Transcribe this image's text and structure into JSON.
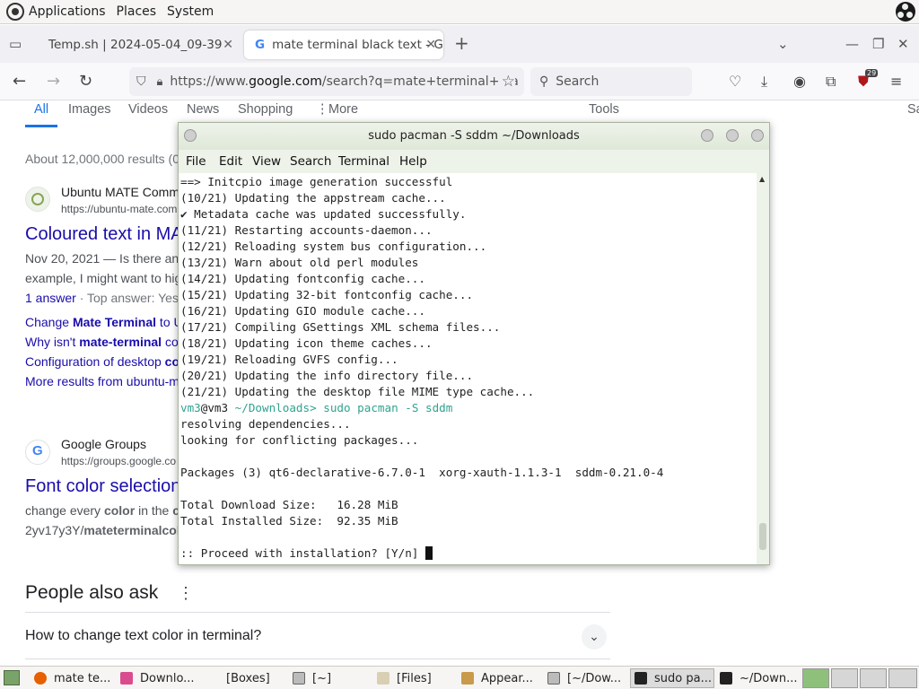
{
  "top_panel": {
    "menus": [
      "Applications",
      "Places",
      "System"
    ]
  },
  "browser": {
    "tabs": [
      {
        "title": "Temp.sh | 2024-05-04_09-39",
        "close": "✕"
      },
      {
        "title": "mate terminal black text - G",
        "close": "✕"
      }
    ],
    "new_tab": "+",
    "url_prefix": "https://www.",
    "url_domain": "google.com",
    "url_rest": "/search?q=mate+terminal+bla",
    "search_placeholder": "Search",
    "badge_count": "29"
  },
  "google": {
    "tabs": [
      "All",
      "Images",
      "Videos",
      "News",
      "Shopping",
      "More",
      "Tools",
      "Sa"
    ],
    "results_count": "About 12,000,000 results (0",
    "result1": {
      "site": "Ubuntu MATE Comm",
      "url": "https://ubuntu-mate.com",
      "title": "Coloured text in MA",
      "snippet_line1": "Nov 20, 2021 — Is there an",
      "snippet_line2": "example, I might want to hig",
      "answers": "1 answer",
      "top_answer": " · Top answer: Yes",
      "links": [
        {
          "prefix": "Change ",
          "bold": "Mate Terminal",
          "suffix": " to U"
        },
        {
          "prefix": "Why isn't ",
          "bold": "mate-terminal",
          "suffix": " co"
        },
        {
          "prefix": "Configuration of desktop ",
          "bold": "co",
          "suffix": ""
        }
      ],
      "more": "More results from ubuntu-m"
    },
    "result2": {
      "site": "Google Groups",
      "url": "https://groups.google.co",
      "title": "Font color selection",
      "snippet_a_prefix": "change every ",
      "snippet_a_bold": "color",
      "snippet_a_suffix": " in the ",
      "snippet_a_end": "c",
      "snippet_b_prefix": "2yv17y3Y/",
      "snippet_b_bold": "mateterminalcol"
    },
    "people_also_ask": "People also ask",
    "paa_q1": "How to change text color in terminal?"
  },
  "terminal": {
    "title": "sudo pacman -S sddm ~/Downloads",
    "menu": [
      "File",
      "Edit",
      "View",
      "Search",
      "Terminal",
      "Help"
    ],
    "lines": [
      "==> Initcpio image generation successful",
      "(10/21) Updating the appstream cache...",
      "✔ Metadata cache was updated successfully.",
      "(11/21) Restarting accounts-daemon...",
      "(12/21) Reloading system bus configuration...",
      "(13/21) Warn about old perl modules",
      "(14/21) Updating fontconfig cache...",
      "(15/21) Updating 32-bit fontconfig cache...",
      "(16/21) Updating GIO module cache...",
      "(17/21) Compiling GSettings XML schema files...",
      "(18/21) Updating icon theme caches...",
      "(19/21) Reloading GVFS config...",
      "(20/21) Updating the info directory file...",
      "(21/21) Updating the desktop file MIME type cache..."
    ],
    "prompt_user": "vm3",
    "prompt_at": "@vm3",
    "prompt_path": " ~/Downloads> ",
    "prompt_cmd": "sudo pacman -S sddm",
    "lines2": [
      "resolving dependencies...",
      "looking for conflicting packages...",
      "",
      "Packages (3) qt6-declarative-6.7.0-1  xorg-xauth-1.1.3-1  sddm-0.21.0-4",
      "",
      "Total Download Size:   16.28 MiB",
      "Total Installed Size:  92.35 MiB",
      ""
    ],
    "proceed": ":: Proceed with installation? [Y/n] "
  },
  "taskbar": {
    "items": [
      "mate te...",
      "Downlo...",
      "[Boxes]",
      "[~]",
      "[Files]",
      "Appear...",
      "[~/Dow...",
      "sudo pa...",
      "~/Down..."
    ]
  }
}
